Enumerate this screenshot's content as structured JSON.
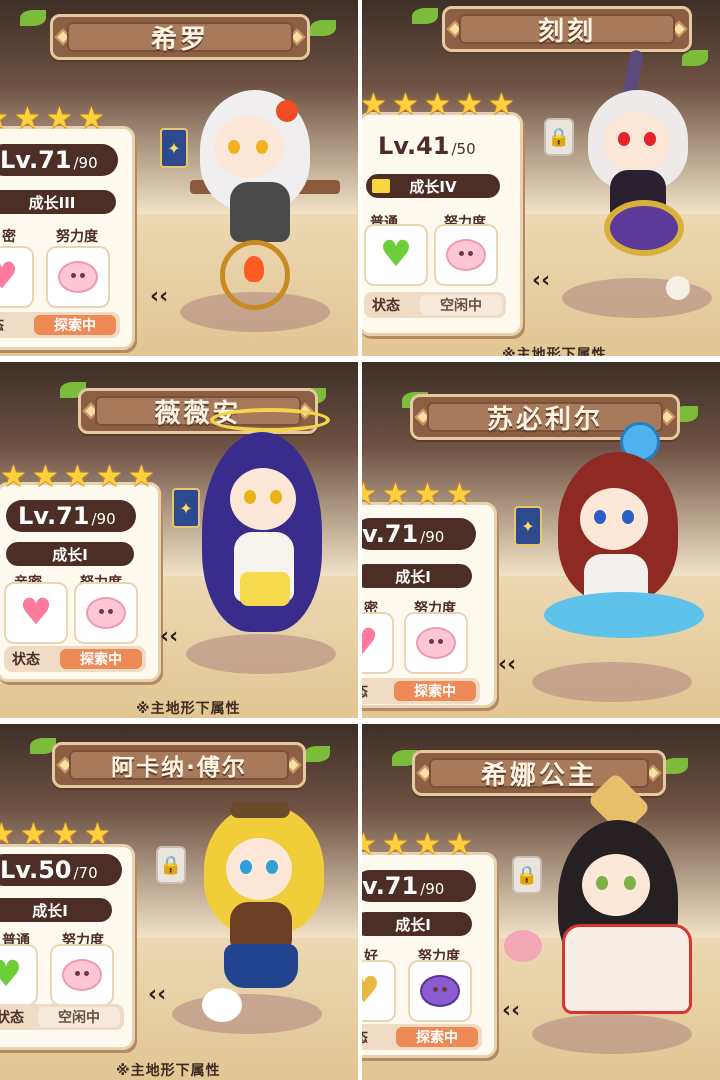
{
  "panels": [
    {
      "name": "希罗",
      "stars": 5,
      "level": "Lv.71",
      "level_max": "/90",
      "growth": "成长III",
      "labels": {
        "left": "密",
        "right": "努力度"
      },
      "status_key": "态",
      "status_value": "探索中",
      "status_style": "explore",
      "heart": "pink",
      "badge": "card",
      "footnote": ""
    },
    {
      "name": "刻刻",
      "stars": 5,
      "level": "Lv.41",
      "level_max": "/50",
      "growth": "成长IV",
      "labels": {
        "left": "普通",
        "right": "努力度"
      },
      "status_key": "状态",
      "status_value": "空闲中",
      "status_style": "idle",
      "heart": "green",
      "badge": "lock",
      "footnote": "※主地形下属性"
    },
    {
      "name": "薇薇安",
      "stars": 5,
      "level": "Lv.71",
      "level_max": "/90",
      "growth": "成长I",
      "labels": {
        "left": "亲密",
        "right": "努力度"
      },
      "status_key": "状态",
      "status_value": "探索中",
      "status_style": "explore",
      "heart": "pink",
      "badge": "card",
      "footnote": "※主地形下属性"
    },
    {
      "name": "苏必利尔",
      "stars": 5,
      "level": "v.71",
      "level_max": "/90",
      "growth": "成长I",
      "labels": {
        "left": "密",
        "right": "努力度"
      },
      "status_key": "态",
      "status_value": "探索中",
      "status_style": "explore",
      "heart": "pink",
      "badge": "card",
      "footnote": ""
    },
    {
      "name": "阿卡纳·傅尔",
      "stars": 5,
      "level": "Lv.50",
      "level_max": "/70",
      "growth": "成长I",
      "labels": {
        "left": "普通",
        "right": "努力度"
      },
      "status_key": "状态",
      "status_value": "空闲中",
      "status_style": "idle",
      "heart": "green",
      "badge": "lock",
      "footnote": "※主地形下属性"
    },
    {
      "name": "希娜公主",
      "stars": 5,
      "level": "v.71",
      "level_max": "/90",
      "growth": "成长I",
      "labels": {
        "left": "好",
        "right": "努力度"
      },
      "status_key": "态",
      "status_value": "探索中",
      "status_style": "explore",
      "heart": "gold",
      "badge": "lock",
      "footnote": ""
    }
  ],
  "icons": {
    "star": "star-icon",
    "heart": "heart-icon",
    "effort": "effort-face-icon",
    "lock": "lock-icon",
    "card": "tarot-card-icon",
    "chevron": "chevron-left-icon"
  },
  "colors": {
    "banner": "#8a5f44",
    "level_bg": "#4d2e25",
    "explore": "#ee8a56",
    "idle": "#f6eadb",
    "star": "#ffd03a"
  }
}
